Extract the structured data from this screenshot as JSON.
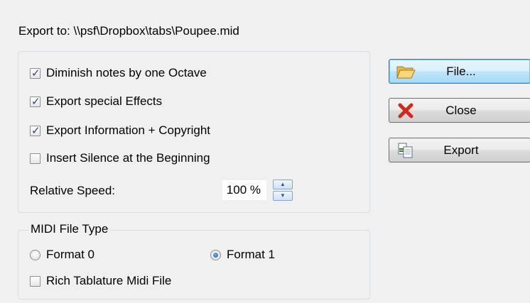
{
  "export_path": "Export to: \\\\psf\\Dropbox\\tabs\\Poupee.mid",
  "options": {
    "diminish_octave": {
      "label": "Diminish notes by one Octave",
      "checked": true
    },
    "export_effects": {
      "label": "Export special Effects",
      "checked": true
    },
    "export_info": {
      "label": "Export Information + Copyright",
      "checked": true
    },
    "insert_silence": {
      "label": "Insert Silence at the Beginning",
      "checked": false
    },
    "speed_label": "Relative Speed:",
    "speed_value": "100 %"
  },
  "midi": {
    "title": "MIDI File Type",
    "format0": {
      "label": "Format 0",
      "selected": false
    },
    "format1": {
      "label": "Format 1",
      "selected": true
    },
    "rich_tablature": {
      "label": "Rich Tablature Midi File",
      "checked": false
    }
  },
  "buttons": {
    "file": "File...",
    "close": "Close",
    "export": "Export"
  },
  "icons": {
    "file": "folder-open-icon",
    "close": "red-x-icon",
    "export": "export-document-icon"
  }
}
